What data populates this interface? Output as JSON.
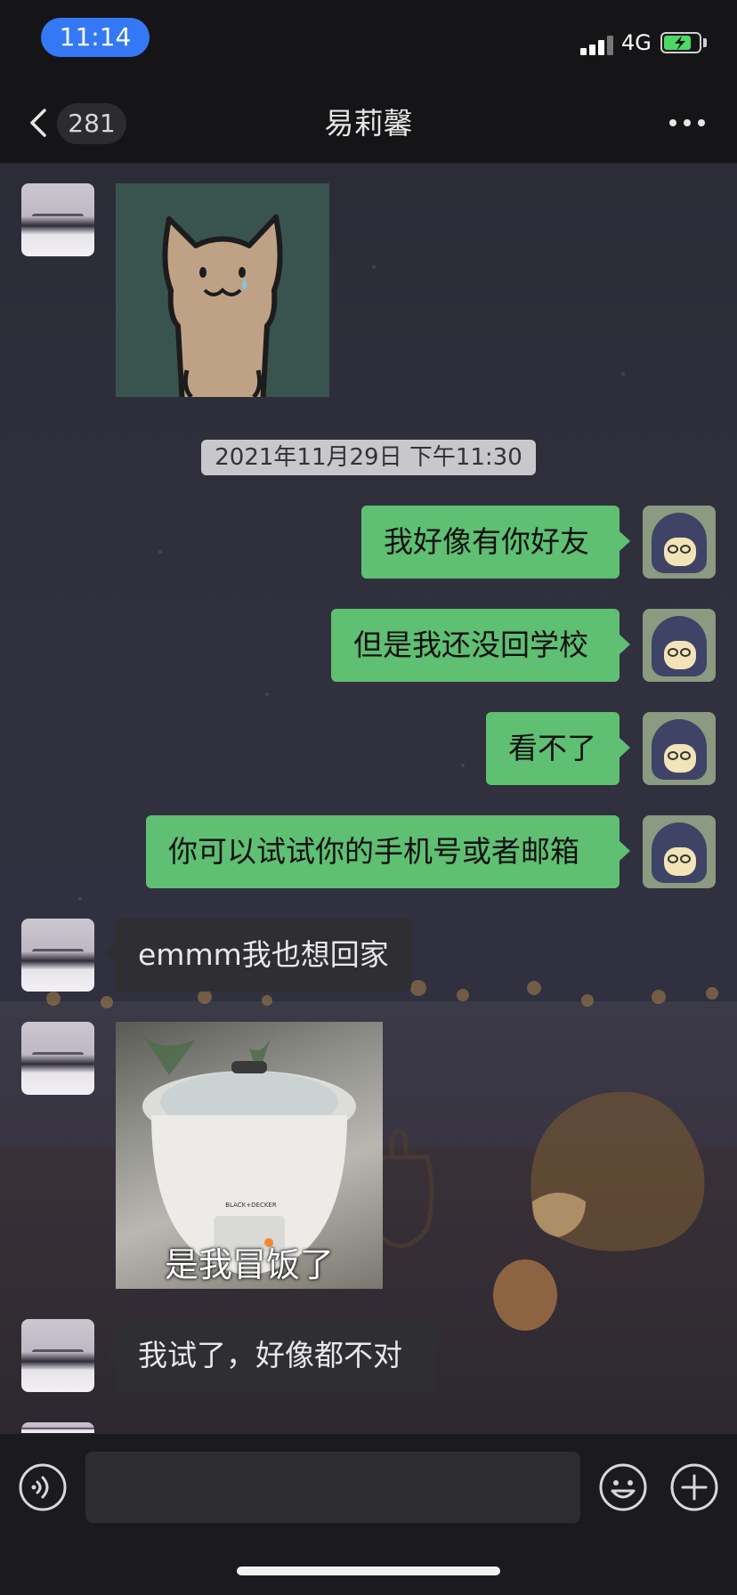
{
  "status_bar": {
    "time": "11:14",
    "network": "4G",
    "battery_level": 0.8,
    "charging": true
  },
  "nav": {
    "back_count": "281",
    "title": "易莉馨",
    "icons": {
      "back": "chevron-left-icon",
      "more": "more-dots-icon"
    }
  },
  "chat": {
    "timestamp": "2021年11月29日 下午11:30",
    "messages": [
      {
        "from": "contact",
        "type": "sticker",
        "content": "crying-cat-sticker"
      },
      {
        "from": "me",
        "type": "text",
        "text": "我好像有你好友"
      },
      {
        "from": "me",
        "type": "text",
        "text": "但是我还没回学校"
      },
      {
        "from": "me",
        "type": "text",
        "text": "看不了"
      },
      {
        "from": "me",
        "type": "text",
        "text": "你可以试试你的手机号或者邮箱"
      },
      {
        "from": "contact",
        "type": "text",
        "text": "emmm我也想回家"
      },
      {
        "from": "contact",
        "type": "image",
        "caption": "是我冒饭了",
        "product_label": "BLACK+DECKER"
      },
      {
        "from": "contact",
        "type": "text",
        "text": "我试了，好像都不对"
      }
    ]
  },
  "input_bar": {
    "value": "",
    "icons": {
      "voice": "voice-icon",
      "emoji": "emoji-icon",
      "plus": "plus-icon"
    }
  },
  "colors": {
    "accent": "#3478f6",
    "bubble_out": "#5fbf72",
    "bubble_in": "#2e2e33"
  }
}
